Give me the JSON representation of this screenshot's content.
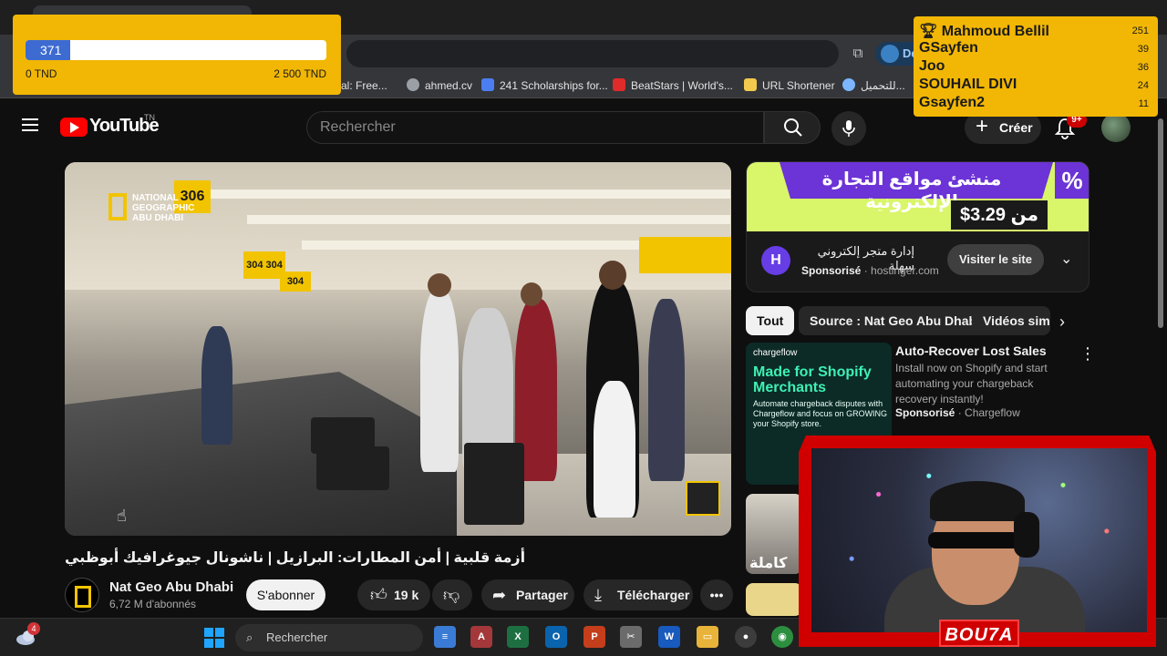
{
  "browser": {
    "bookmarks": [
      {
        "label": "val: Free...",
        "icon": "bookmark-icon",
        "color": "#f29900"
      },
      {
        "label": "ahmed.cv",
        "icon": "globe-icon",
        "color": "#9aa0a6"
      },
      {
        "label": "241 Scholarships for...",
        "icon": "graduation-icon",
        "color": "#4c7ef3"
      },
      {
        "label": "BeatStars | World's...",
        "icon": "beatstars-icon",
        "color": "#e02b2b"
      },
      {
        "label": "URL Shortener",
        "icon": "folder-icon",
        "color": "#f2c94c"
      },
      {
        "label": "للتحميل...",
        "icon": "gear-icon",
        "color": "#7bb6ff"
      }
    ],
    "profile_button_label": "De"
  },
  "youtube": {
    "logo_text": "YouTube",
    "country_code": "TN",
    "search_placeholder": "Rechercher",
    "create_label": "Créer",
    "notification_count": "9+"
  },
  "video": {
    "title": "أزمة قلبية | أمن المطارات: البرازيل | ناشونال جيوغرافيك أبوظبي",
    "overlay_brand": "NATIONAL GEOGRAPHIC ABU DHABI",
    "gate_signs": [
      "306",
      "304 304",
      "304"
    ],
    "channel_name": "Nat Geo Abu Dhabi",
    "channel_subscribers": "6,72 M d'abonnés",
    "subscribe_label": "S'abonner",
    "likes": "19 k",
    "share_label": "Partager",
    "download_label": "Télécharger"
  },
  "ad": {
    "headline": "منشئ مواقع التجارة الإلكترونية",
    "price": "من 3.29$",
    "badge": "%",
    "title": "إدارة متجر إلكتروني سهلة",
    "sponsored_label": "Sponsorisé",
    "domain": "hostinger.com",
    "logo_letter": "H",
    "visit_label": "Visiter le site"
  },
  "chips": [
    "Tout",
    "Source : Nat Geo Abu Dhabi",
    "Vidéos simi"
  ],
  "recommendation": {
    "thumb_brand": "chargeflow",
    "thumb_headline": "Made for Shopify Merchants",
    "thumb_text": "Automate chargeback disputes with Chargeflow and focus on GROWING your Shopify store.",
    "title": "Auto-Recover Lost Sales",
    "description": "Install now on Shopify and start automating your chargeback recovery instantly!",
    "sponsored_label": "Sponsorisé",
    "advertiser": "Chargeflow",
    "second_thumb_text": "كاملة"
  },
  "donation_goal": {
    "current": "371",
    "min_label": "0 TND",
    "max_label": "2 500 TND",
    "progress_fraction": 0.148
  },
  "leaderboard": [
    {
      "name": "Mahmoud Bellil",
      "score": "251",
      "trophy": true
    },
    {
      "name": "GSayfen",
      "score": "39"
    },
    {
      "name": "Joo",
      "score": "36"
    },
    {
      "name": "SOUHAIL DIVI",
      "score": "24"
    },
    {
      "name": "Gsayfen2",
      "score": "11"
    }
  ],
  "webcam": {
    "label": "BOU7A"
  },
  "taskbar": {
    "weather_badge": "4",
    "search_placeholder": "Rechercher",
    "apps": [
      {
        "name": "notepad-app",
        "glyph": "≡",
        "color": "#3a7bd5"
      },
      {
        "name": "access-app",
        "glyph": "A",
        "color": "#a4373a"
      },
      {
        "name": "excel-app",
        "glyph": "X",
        "color": "#1d6f42"
      },
      {
        "name": "outlook-app",
        "glyph": "O",
        "color": "#0a64ad"
      },
      {
        "name": "powerpoint-app",
        "glyph": "P",
        "color": "#c43e1c"
      },
      {
        "name": "snipping-app",
        "glyph": "✂",
        "color": "#6b6b6b"
      },
      {
        "name": "word-app",
        "glyph": "W",
        "color": "#185abd"
      },
      {
        "name": "explorer-app",
        "glyph": "▭",
        "color": "#e8b339"
      },
      {
        "name": "obs-app",
        "glyph": "●",
        "color": "#3c3c3c"
      },
      {
        "name": "chrome-app",
        "glyph": "◉",
        "color": "#2c8f3f"
      }
    ]
  },
  "colors": {
    "overlay_yellow": "#f2b704",
    "progress_blue": "#3d6bd1",
    "youtube_red": "#ff0000",
    "cam_red": "#d00000"
  }
}
